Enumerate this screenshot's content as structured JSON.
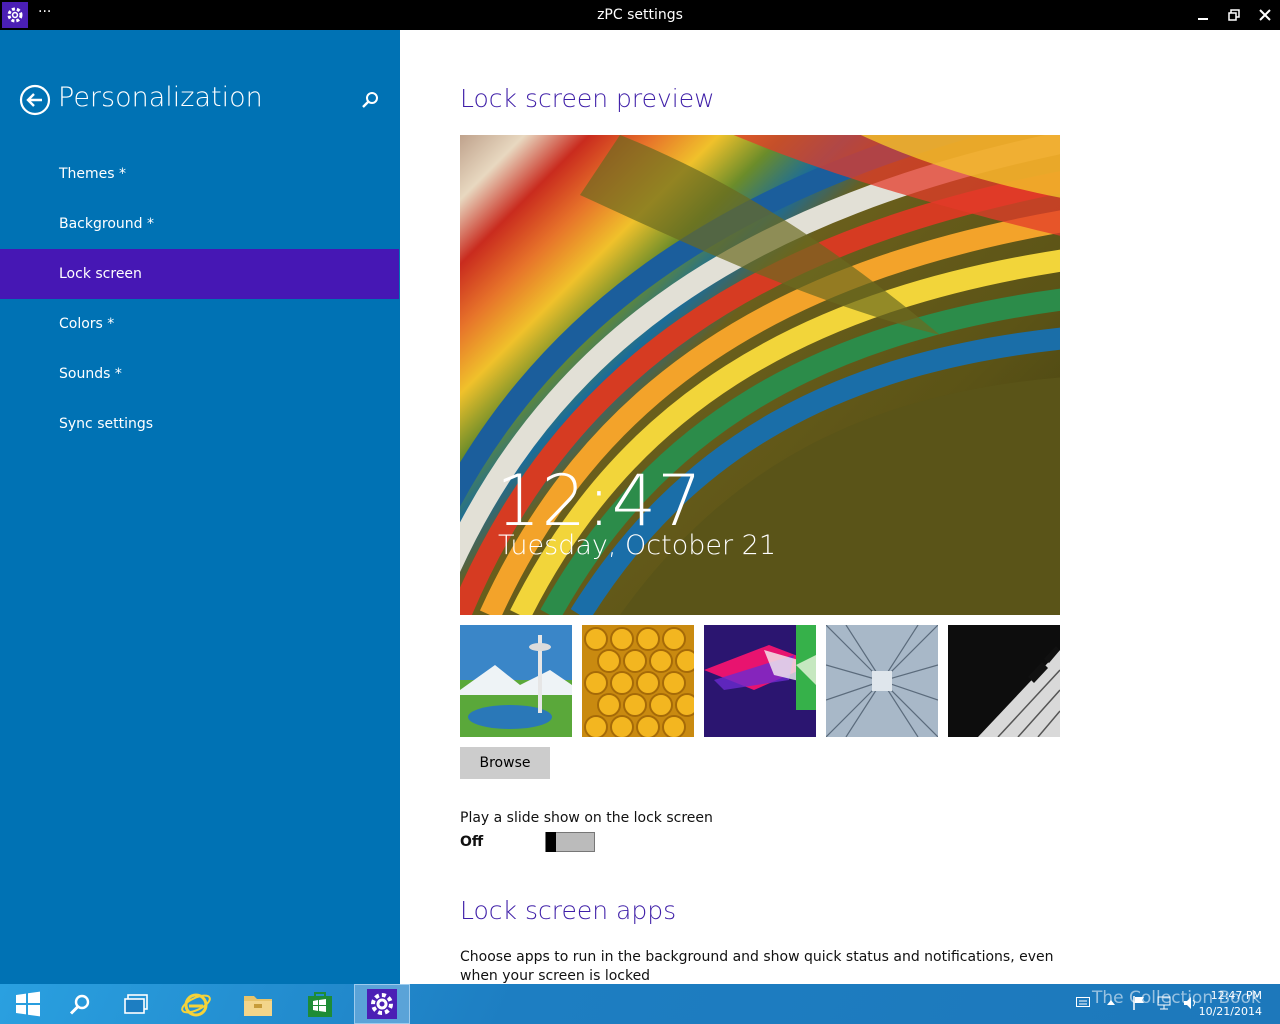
{
  "window": {
    "title": "zPC settings",
    "menu_dots": "···"
  },
  "sidebar": {
    "title": "Personalization",
    "items": [
      {
        "label": "Themes *"
      },
      {
        "label": "Background *"
      },
      {
        "label": "Lock screen"
      },
      {
        "label": "Colors *"
      },
      {
        "label": "Sounds *"
      },
      {
        "label": "Sync settings"
      }
    ]
  },
  "main": {
    "preview_heading": "Lock screen preview",
    "preview_time": "12:47",
    "preview_date": "Tuesday, October 21",
    "browse_label": "Browse",
    "slideshow_label": "Play a slide show on the lock screen",
    "slideshow_state": "Off",
    "apps_heading": "Lock screen apps",
    "apps_description": "Choose apps to run in the background and show quick status and notifications, even when your screen is locked"
  },
  "taskbar": {
    "clock_time": "12:47 PM",
    "clock_date": "10/21/2014",
    "watermark": "The Collection Book"
  },
  "colors": {
    "sidebar_bg": "#0072b4",
    "accent": "#4617b4",
    "heading": "#3f1fa8"
  }
}
